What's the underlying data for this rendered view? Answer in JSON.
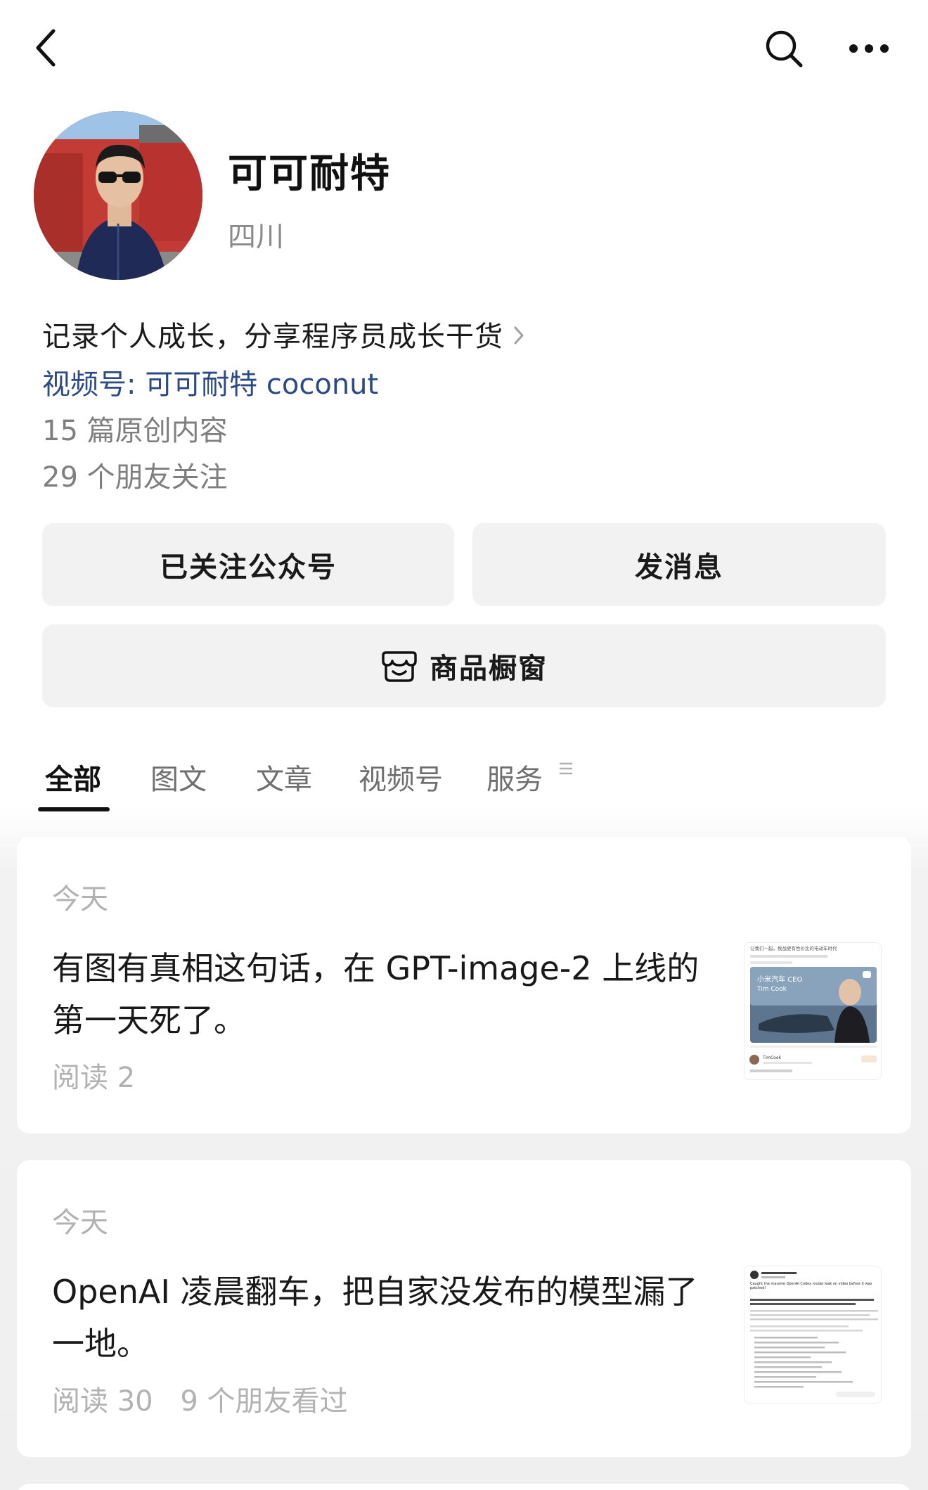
{
  "topbar": {
    "back_icon": "chevron-left-icon",
    "search_icon": "search-icon",
    "more_icon": "more-horizontal-icon"
  },
  "profile": {
    "name": "可可耐特",
    "region": "四川",
    "bio": "记录个人成长，分享程序员成长干货",
    "channel": "视频号: 可可耐特 coconut",
    "originals": "15 篇原创内容",
    "friends_following": "29 个朋友关注"
  },
  "actions": {
    "follow_label": "已关注公众号",
    "message_label": "发消息",
    "shop_label": "商品橱窗",
    "shop_icon": "shop-window-icon"
  },
  "tabs": [
    {
      "label": "全部",
      "active": true
    },
    {
      "label": "图文",
      "active": false
    },
    {
      "label": "文章",
      "active": false
    },
    {
      "label": "视频号",
      "active": false
    },
    {
      "label": "服务",
      "active": false
    }
  ],
  "articles": [
    {
      "date": "今天",
      "title": "有图有真相这句话，在 GPT-image-2 上线的第一天死了。",
      "reads": "阅读 2",
      "friends_seen": "",
      "thumb": {
        "caption_top": "让我们一起，挑战更有性价比的电动车时代",
        "card_title": "小米汽车 CEO",
        "card_name": "Tim Cook",
        "user": "TimCook"
      }
    },
    {
      "date": "今天",
      "title": "OpenAI 凌晨翻车，把自家没发布的模型漏了一地。",
      "reads": "阅读 30",
      "friends_seen": "9 个朋友看过",
      "thumb": {
        "header": "Caught the massive OpenAI Codex model leak on video before it was patched!"
      }
    }
  ],
  "colors": {
    "link_blue": "#2b4a86",
    "muted_gray": "#7f7f7f",
    "button_bg": "#f2f2f2",
    "page_bg": "#efefef"
  }
}
